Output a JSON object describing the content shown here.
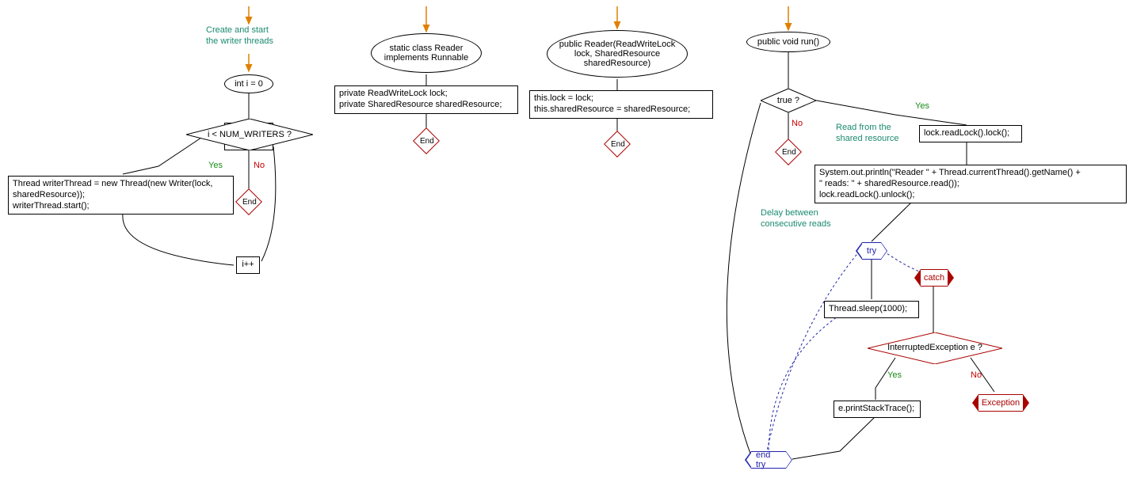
{
  "chart1": {
    "comment": "Create and start\nthe writer threads",
    "init": "int i = 0",
    "cond": "i < NUM_WRITERS ?",
    "body": "Thread writerThread = new Thread(new Writer(lock,\nsharedResource));\nwriterThread.start();",
    "incr": "i++",
    "yes": "Yes",
    "no": "No",
    "end": "End"
  },
  "chart2": {
    "title": "static class Reader\nimplements Runnable",
    "body": "private ReadWriteLock lock;\nprivate SharedResource sharedResource;",
    "end": "End"
  },
  "chart3": {
    "title": "public Reader(ReadWriteLock\nlock, SharedResource\nsharedResource)",
    "body": "this.lock = lock;\nthis.sharedResource = sharedResource;",
    "end": "End"
  },
  "chart4": {
    "title": "public void run()",
    "cond": "true ?",
    "yes": "Yes",
    "no": "No",
    "end": "End",
    "comment_read": "Read from the\nshared resource",
    "lock": "lock.readLock().lock();",
    "body": "System.out.println(\"Reader \" + Thread.currentThread().getName() +\n\" reads: \" + sharedResource.read());\nlock.readLock().unlock();",
    "comment_delay": "Delay between\nconsecutive reads",
    "try": "try",
    "sleep": "Thread.sleep(1000);",
    "catch": "catch",
    "exc_cond": "InterruptedException e ?",
    "exc_yes": "Yes",
    "exc_no": "No",
    "exc_handler": "e.printStackTrace();",
    "exception_label": "Exception",
    "endtry": "end try"
  }
}
